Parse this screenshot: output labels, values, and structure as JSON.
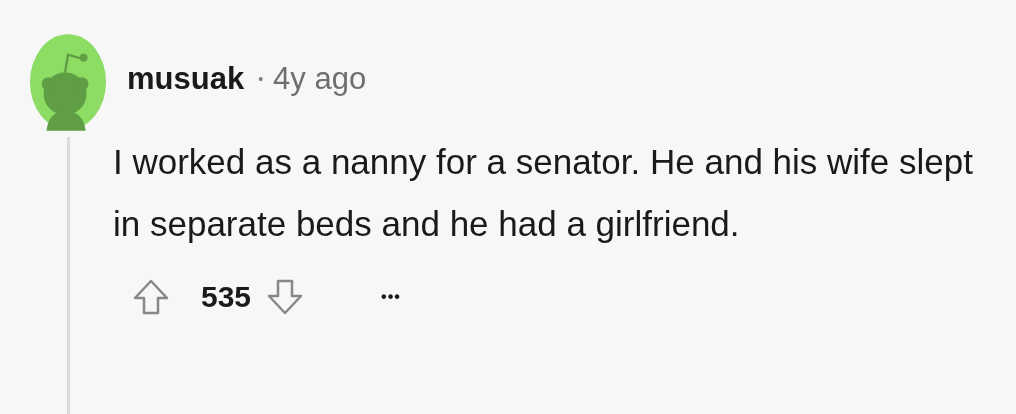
{
  "comment": {
    "author": "musuak",
    "separator": "•",
    "age": "4y ago",
    "body": "I worked as a nanny for a senator. He and his wife slept in separate beds and he had a girlfriend.",
    "score": "535",
    "more": "•••"
  }
}
